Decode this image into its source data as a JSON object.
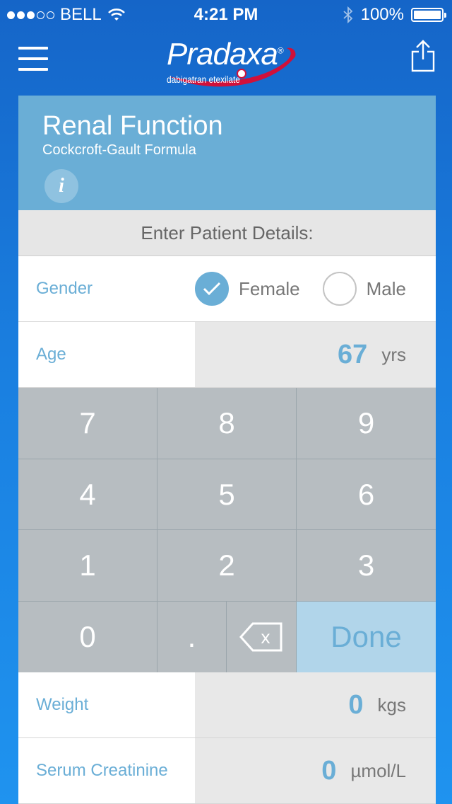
{
  "status_bar": {
    "carrier": "BELL",
    "time": "4:21 PM",
    "battery": "100%"
  },
  "nav": {
    "logo_brand": "Pradaxa",
    "logo_trademark": "®",
    "logo_generic": "dabigatran etexilate"
  },
  "card": {
    "title": "Renal Function",
    "subtitle": "Cockcroft-Gault Formula",
    "info_glyph": "i"
  },
  "form": {
    "section_label": "Enter Patient Details:",
    "gender": {
      "label": "Gender",
      "options": [
        {
          "label": "Female",
          "selected": true
        },
        {
          "label": "Male",
          "selected": false
        }
      ]
    },
    "age": {
      "label": "Age",
      "value": "67",
      "unit": "yrs"
    },
    "weight": {
      "label": "Weight",
      "value": "0",
      "unit": "kgs"
    },
    "creatinine": {
      "label": "Serum Creatinine",
      "value": "0",
      "unit": "µmol/L"
    }
  },
  "keypad": {
    "keys": [
      "7",
      "8",
      "9",
      "4",
      "5",
      "6",
      "1",
      "2",
      "3",
      "0",
      "."
    ],
    "backspace_glyph": "x",
    "done_label": "Done"
  },
  "colors": {
    "accent": "#6aaed6",
    "done_key": "#b1d5ea",
    "key": "#b7bdc1",
    "value_bg": "#e8e8e8",
    "logo_swoosh": "#d0103a"
  },
  "icons": {
    "menu": "hamburger-icon",
    "share": "share-icon",
    "info": "info-icon",
    "check": "checkmark-icon",
    "backspace": "backspace-icon",
    "wifi": "wifi-icon",
    "bluetooth": "bluetooth-icon",
    "battery": "battery-icon"
  }
}
